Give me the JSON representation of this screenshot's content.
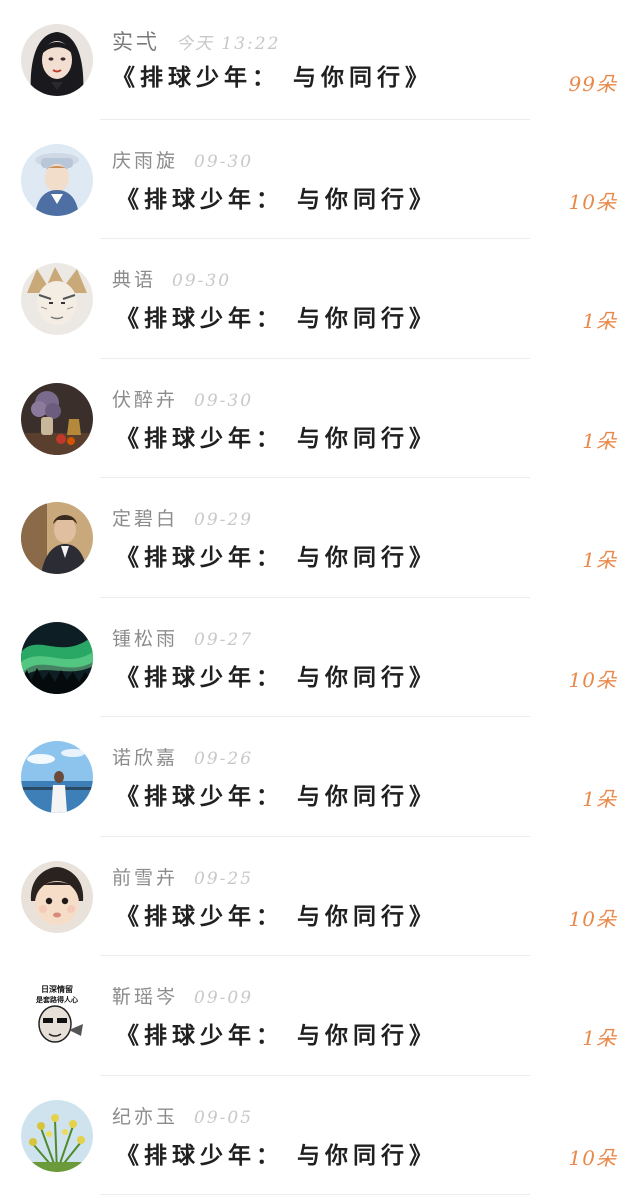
{
  "items": [
    {
      "name": "实弌",
      "time": "今天 13:22",
      "title": "《排球少年： 与你同行》",
      "count": "99朵",
      "avatar": "avatar-girl-icon"
    },
    {
      "name": "庆雨旋",
      "time": "09-30",
      "title": "《排球少年： 与你同行》",
      "count": "10朵",
      "avatar": "avatar-anime-boy-icon"
    },
    {
      "name": "典语",
      "time": "09-30",
      "title": "《排球少年： 与你同行》",
      "count": "1朵",
      "avatar": "avatar-sketch-icon"
    },
    {
      "name": "伏醉卉",
      "time": "09-30",
      "title": "《排球少年： 与你同行》",
      "count": "1朵",
      "avatar": "avatar-still-life-icon"
    },
    {
      "name": "定碧白",
      "time": "09-29",
      "title": "《排球少年： 与你同行》",
      "count": "1朵",
      "avatar": "avatar-man-icon"
    },
    {
      "name": "锺松雨",
      "time": "09-27",
      "title": "《排球少年： 与你同行》",
      "count": "10朵",
      "avatar": "avatar-aurora-icon"
    },
    {
      "name": "诺欣嘉",
      "time": "09-26",
      "title": "《排球少年： 与你同行》",
      "count": "1朵",
      "avatar": "avatar-beach-icon"
    },
    {
      "name": "前雪卉",
      "time": "09-25",
      "title": "《排球少年： 与你同行》",
      "count": "10朵",
      "avatar": "avatar-baby-icon"
    },
    {
      "name": "靳瑶岑",
      "time": "09-09",
      "title": "《排球少年： 与你同行》",
      "count": "1朵",
      "avatar": "avatar-meme-icon",
      "avatar_text_lines": [
        "日深情留",
        "是套路得人心"
      ]
    },
    {
      "name": "纪亦玉",
      "time": "09-05",
      "title": "《排球少年： 与你同行》",
      "count": "10朵",
      "avatar": "avatar-flowers-icon"
    }
  ],
  "colors": {
    "count": "#e8894a",
    "username": "#8c8c8c",
    "timestamp": "#c8c8c8",
    "title": "#202020",
    "divider": "#ececec"
  }
}
